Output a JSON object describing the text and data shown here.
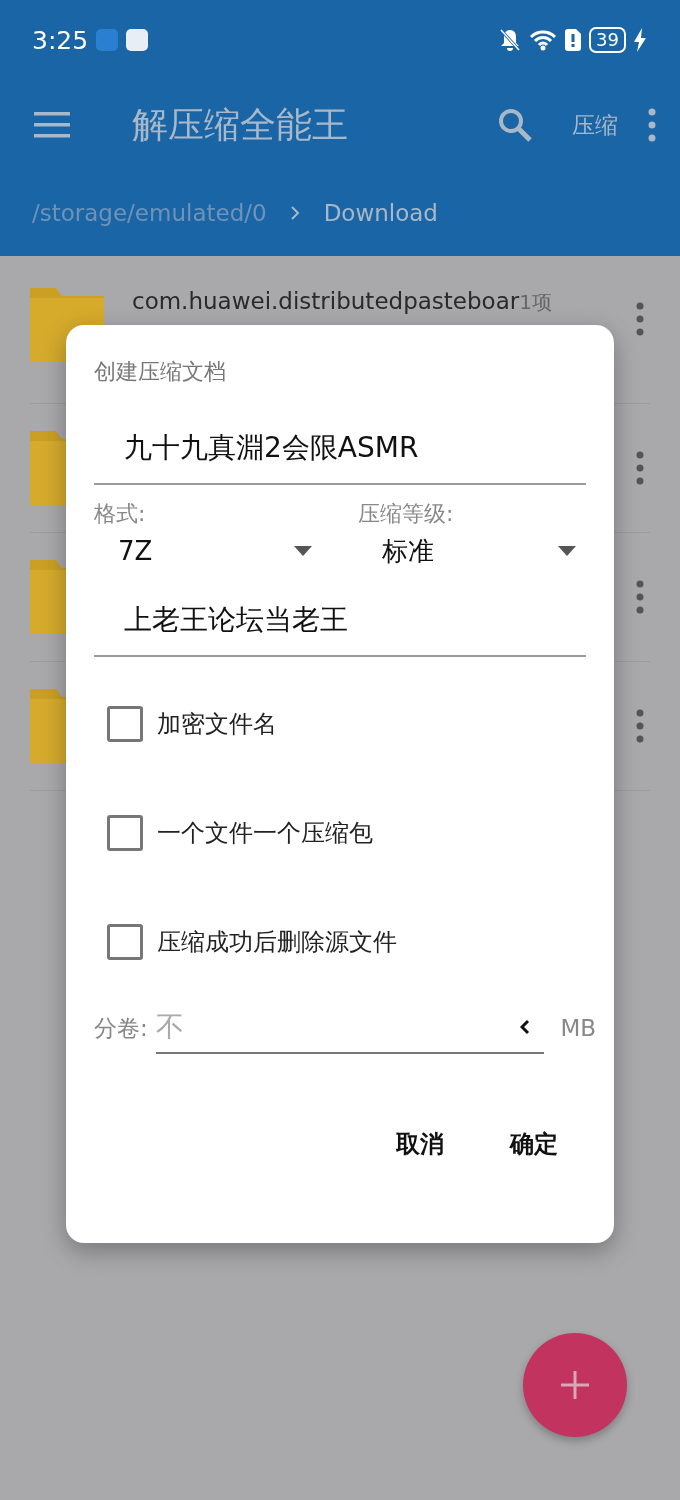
{
  "status_bar": {
    "time": "3:25",
    "battery": "39"
  },
  "app_bar": {
    "title": "解压缩全能王",
    "action": "压缩"
  },
  "breadcrumb": {
    "items": [
      {
        "label": "/storage/emulated/0",
        "selected": false
      },
      {
        "label": "Download",
        "selected": true
      }
    ]
  },
  "files": [
    {
      "kind": "folder",
      "name": "com.huawei.distributedpasteboar",
      "count": "1项"
    },
    {
      "kind": "folder"
    },
    {
      "kind": "folder"
    },
    {
      "kind": "folder"
    }
  ],
  "dialog": {
    "title": "创建压缩文档",
    "name_field": {
      "value": "九十九真淵2会限ASMR"
    },
    "format": {
      "label": "格式:",
      "value": "7Z"
    },
    "level": {
      "label": "压缩等级:",
      "value": "标准"
    },
    "password_field": {
      "value": "上老王论坛当老王"
    },
    "options": [
      {
        "label": "加密文件名",
        "checked": false
      },
      {
        "label": "一个文件一个压缩包",
        "checked": false
      },
      {
        "label": "压缩成功后删除源文件",
        "checked": false
      }
    ],
    "split": {
      "label": "分卷:",
      "placeholder": "不",
      "unit": "MB"
    },
    "buttons": [
      "取消",
      "确定"
    ]
  }
}
